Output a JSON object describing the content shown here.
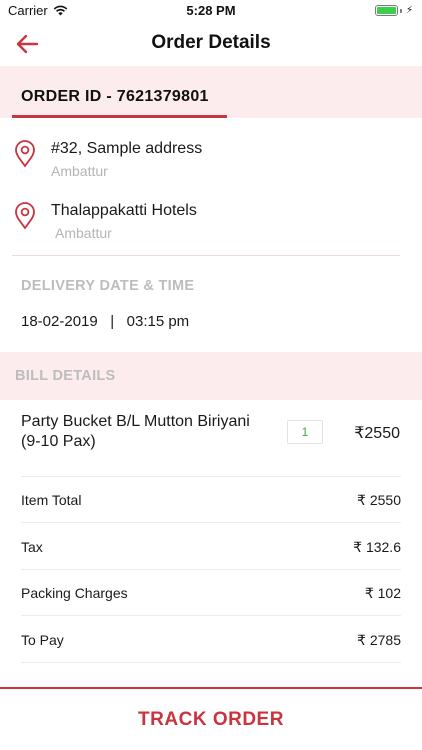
{
  "status_bar": {
    "carrier": "Carrier",
    "time": "5:28 PM"
  },
  "nav": {
    "title": "Order Details"
  },
  "order": {
    "id_label": "ORDER ID - 7621379801"
  },
  "addresses": [
    {
      "title": "#32, Sample address",
      "subtitle": "Ambattur"
    },
    {
      "title": "Thalappakatti Hotels",
      "subtitle": "Ambattur"
    }
  ],
  "delivery": {
    "label": "DELIVERY DATE & TIME",
    "value": "18-02-2019   |   03:15 pm"
  },
  "bill": {
    "label": "BILL DETAILS",
    "item": {
      "name": "Party Bucket B/L Mutton Biriyani (9-10 Pax)",
      "quantity": "1",
      "price": "₹2550"
    },
    "lines": [
      {
        "label": "Item Total",
        "value": "₹ 2550"
      },
      {
        "label": "Tax",
        "value": "₹ 132.6"
      },
      {
        "label": "Packing Charges",
        "value": "₹ 102"
      },
      {
        "label": "To Pay",
        "value": "₹ 2785"
      }
    ]
  },
  "footer": {
    "button_label": "TRACK ORDER"
  },
  "colors": {
    "accent": "#c8353f",
    "band": "#fcecee",
    "muted": "#b4b4b4",
    "qty": "#3aa64a"
  }
}
